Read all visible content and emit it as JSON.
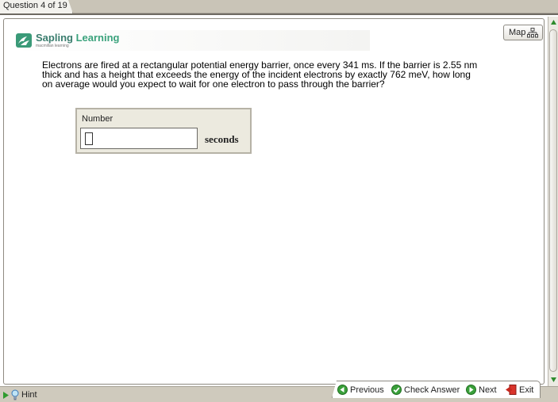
{
  "tab": {
    "label": "Question 4 of 19"
  },
  "brand": {
    "word1": "Sapling",
    "word2": "Learning",
    "subtitle": "macmillan learning"
  },
  "map": {
    "label": "Map"
  },
  "question": {
    "line1": "Electrons are fired at a rectangular potential energy barrier, once every 341 ms. If the barrier is 2.55 nm",
    "line2": "thick and has a height that exceeds the energy of the incident electrons by exactly 762 meV, how long",
    "line3": "on average would you expect to wait for one electron to pass through the barrier?"
  },
  "answer": {
    "label": "Number",
    "value": "",
    "unit": "seconds"
  },
  "footer": {
    "hint": "Hint",
    "previous": "Previous",
    "check": "Check Answer",
    "next": "Next",
    "exit": "Exit"
  },
  "colors": {
    "brand_dark": "#3a7d6e",
    "brand_light": "#3aa27c",
    "nav_green": "#39a039",
    "exit_red": "#c8281e"
  }
}
